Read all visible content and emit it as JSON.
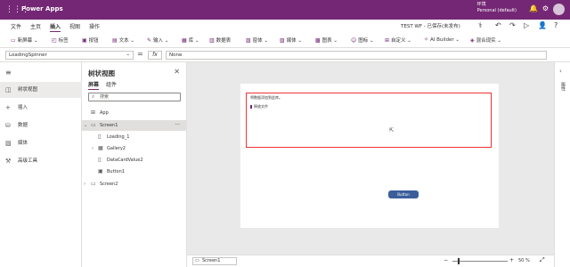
{
  "app": {
    "name": "Power Apps"
  },
  "account": {
    "line1": "环境",
    "line2": "Personal (default)"
  },
  "menu": {
    "items": [
      {
        "label": "文件",
        "active": false
      },
      {
        "label": "主页",
        "active": false
      },
      {
        "label": "插入",
        "active": true
      },
      {
        "label": "视图",
        "active": false
      },
      {
        "label": "操作",
        "active": false
      }
    ],
    "status": "TEST WF - 已保存(未发布)"
  },
  "ribbon": {
    "items": [
      {
        "label": "新屏幕",
        "icon": "new-screen-icon"
      },
      {
        "label": "标签",
        "icon": "label-icon"
      },
      {
        "label": "按钮",
        "icon": "button-icon"
      },
      {
        "label": "文本",
        "icon": "text-icon"
      },
      {
        "label": "输入",
        "icon": "input-icon"
      },
      {
        "label": "库",
        "icon": "gallery-icon"
      },
      {
        "label": "数据表",
        "icon": "data-table-icon"
      },
      {
        "label": "窗体",
        "icon": "form-icon"
      },
      {
        "label": "媒体",
        "icon": "media-icon"
      },
      {
        "label": "图表",
        "icon": "chart-icon"
      },
      {
        "label": "图标",
        "icon": "icons-icon"
      },
      {
        "label": "自定义",
        "icon": "custom-icon"
      },
      {
        "label": "AI Builder",
        "icon": "ai-builder-icon"
      },
      {
        "label": "混合现实",
        "icon": "mixed-reality-icon"
      }
    ]
  },
  "formula": {
    "property": "LoadingSpinner",
    "fx": "fx",
    "value": "None"
  },
  "leftnav": {
    "items": [
      {
        "label": "树状视图",
        "icon": "tree-view-icon",
        "active": true
      },
      {
        "label": "插入",
        "icon": "plus-icon",
        "active": false
      },
      {
        "label": "数据",
        "icon": "database-icon",
        "active": false
      },
      {
        "label": "媒体",
        "icon": "media-icon",
        "active": false
      },
      {
        "label": "高级工具",
        "icon": "tools-icon",
        "active": false
      }
    ]
  },
  "tree": {
    "title": "树状视图",
    "tabs": [
      {
        "label": "屏幕",
        "active": true
      },
      {
        "label": "组件",
        "active": false
      }
    ],
    "search_placeholder": "搜索",
    "nodes": [
      {
        "label": "App",
        "indent": 0,
        "icon": "app-icon",
        "selected": false
      },
      {
        "label": "Screen1",
        "indent": 0,
        "icon": "screen-icon",
        "selected": true,
        "expanded": true
      },
      {
        "label": "Loading_1",
        "indent": 1,
        "icon": "control-icon",
        "selected": false
      },
      {
        "label": "Gallery2",
        "indent": 1,
        "icon": "gallery-icon",
        "selected": false,
        "collapsed": true
      },
      {
        "label": "DataCardValue2",
        "indent": 1,
        "icon": "control-icon",
        "selected": false
      },
      {
        "label": "Button1",
        "indent": 1,
        "icon": "button-icon",
        "selected": false
      },
      {
        "label": "Screen2",
        "indent": 0,
        "icon": "screen-icon",
        "selected": false,
        "collapsed": true
      }
    ]
  },
  "canvas": {
    "gallery_hint": "将数据添加到此库。",
    "datacard_label": "释放文件",
    "button_label": "Button"
  },
  "bottom": {
    "screen": "Screen1",
    "zoom_minus": "−",
    "zoom_plus": "+",
    "zoom_pct": "50 %",
    "zoom_level": 0.5
  },
  "rightpanel": {
    "label": "属性"
  },
  "colors": {
    "brand": "#742774",
    "selection_border": "#ee3333",
    "button": "#3b5e9b"
  }
}
